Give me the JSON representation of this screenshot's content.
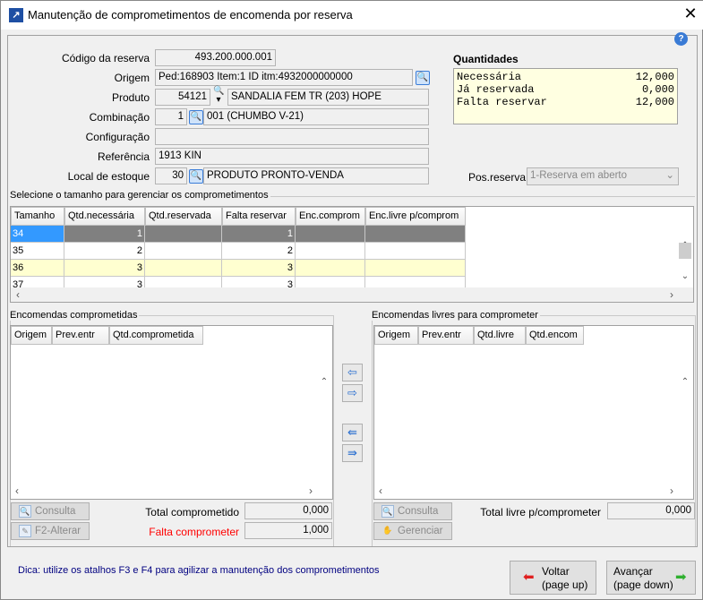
{
  "window": {
    "title": "Manutenção de comprometimentos de encomenda por reserva",
    "close": "✕",
    "help": "?"
  },
  "form": {
    "codigo_label": "Código da reserva",
    "codigo": "493.200.000.001",
    "origem_label": "Origem",
    "origem": "Ped:168903 Item:1 ID itm:4932000000000",
    "produto_label": "Produto",
    "produto_code": "54121",
    "produto_desc": "SANDALIA FEM TR (203) HOPE",
    "combinacao_label": "Combinação",
    "combinacao_code": "1",
    "combinacao_desc": "001 (CHUMBO V-21)",
    "configuracao_label": "Configuração",
    "configuracao": "",
    "referencia_label": "Referência",
    "referencia": "1913 KIN",
    "local_label": "Local de estoque",
    "local_code": "30",
    "local_desc": "PRODUTO PRONTO-VENDA",
    "pos_label": "Pos.reserva",
    "pos_value": "1-Reserva em aberto"
  },
  "quantidades": {
    "title": "Quantidades",
    "rows": [
      {
        "label": "Necessária",
        "value": "12,000"
      },
      {
        "label": "Já reservada",
        "value": "0,000"
      },
      {
        "label": "Falta reservar",
        "value": "12,000"
      }
    ]
  },
  "sizes": {
    "group_title": "Selecione o tamanho para gerenciar os comprometimentos",
    "headers": [
      "Tamanho",
      "Qtd.necessária",
      "Qtd.reservada",
      "Falta reservar",
      "Enc.comprom",
      "Enc.livre p/comprom"
    ],
    "rows": [
      [
        "34",
        "1",
        "",
        "1",
        "",
        ""
      ],
      [
        "35",
        "2",
        "",
        "2",
        "",
        ""
      ],
      [
        "36",
        "3",
        "",
        "3",
        "",
        ""
      ],
      [
        "37",
        "3",
        "",
        "3",
        "",
        ""
      ]
    ]
  },
  "committed": {
    "group_title": "Encomendas comprometidas",
    "headers": [
      "Origem",
      "Prev.entr",
      "Qtd.comprometida"
    ],
    "consulta": "Consulta",
    "alterar": "F2-Alterar",
    "total_label": "Total comprometido",
    "total": "0,000",
    "falta_label": "Falta comprometer",
    "falta": "1,000"
  },
  "free": {
    "group_title": "Encomendas livres para comprometer",
    "headers": [
      "Origem",
      "Prev.entr",
      "Qtd.livre",
      "Qtd.encom"
    ],
    "consulta": "Consulta",
    "gerenciar": "Gerenciar",
    "total_label": "Total livre p/comprometer",
    "total": "0,000"
  },
  "footer": {
    "tip": "Dica: utilize os atalhos F3 e F4 para agilizar a manutenção dos comprometimentos",
    "back_1": "Voltar",
    "back_2": "(page up)",
    "next_1": "Avançar",
    "next_2": "(page down)"
  },
  "colors": {
    "selected": "#808080",
    "selected_first": "#3399ff",
    "highlight": "#ffffd0",
    "warning": "#ff0000",
    "tip": "#000080"
  }
}
